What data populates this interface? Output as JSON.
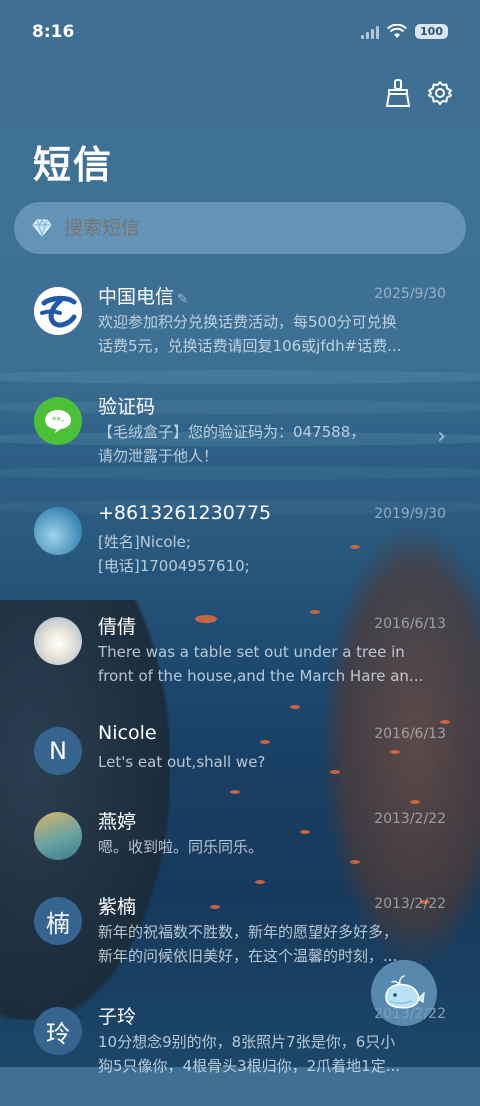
{
  "status_bar": {
    "time": "8:16",
    "battery": "100"
  },
  "header": {
    "title": "短信"
  },
  "search": {
    "placeholder": "搜索短信"
  },
  "messages": [
    {
      "name": "中国电信",
      "date": "2025/9/30",
      "lines": [
        "欢迎参加积分兑换话费活动，每500分可兑换",
        "话费5元，兑换话费请回复106或jfdh#话费..."
      ],
      "avatar": "china-telecom-logo"
    },
    {
      "name": "验证码",
      "date": "",
      "lines": [
        "【毛绒盒子】您的验证码为：047588，",
        "请勿泄露于他人！"
      ],
      "avatar": "verification-code-icon"
    },
    {
      "name": "+8613261230775",
      "date": "2019/9/30",
      "lines": [
        "[姓名]Nicole;",
        "[电话]17004957610;"
      ],
      "avatar": "ocean-photo"
    },
    {
      "name": "倩倩",
      "date": "2016/6/13",
      "lines": [
        "There was a table set out under a tree in",
        "front of the house,and the March Hare an..."
      ],
      "avatar": "polar-bear-photo"
    },
    {
      "name": "Nicole",
      "date": "2016/6/13",
      "lines": [
        "Let's eat out,shall we?"
      ],
      "avatar_letter": "N"
    },
    {
      "name": "燕婷",
      "date": "2013/2/22",
      "lines": [
        "嗯。收到啦。同乐同乐。"
      ],
      "avatar": "landscape-photo"
    },
    {
      "name": "紫楠",
      "date": "2013/2/22",
      "lines": [
        "新年的祝福数不胜数，新年的愿望好多好多，",
        "新年的问候依旧美好，在这个温馨的时刻，..."
      ],
      "avatar_letter": "楠"
    },
    {
      "name": "子玲",
      "date": "2013/2/22",
      "lines": [
        "10分想念9别的你，8张照片7张是你，6只小",
        "狗5只像你，4根骨头3根归你，2爪着地1定..."
      ],
      "avatar_letter": "玲"
    }
  ],
  "colors": {
    "accent": "#35648f",
    "telecom_blue": "#1f5aa6",
    "wechat_green": "#4cc138",
    "fish_orange": "#e06a3c"
  },
  "icons": {
    "clean": "broom-icon",
    "settings": "gear-icon",
    "search": "diamond-icon",
    "fab": "whale-icon"
  }
}
